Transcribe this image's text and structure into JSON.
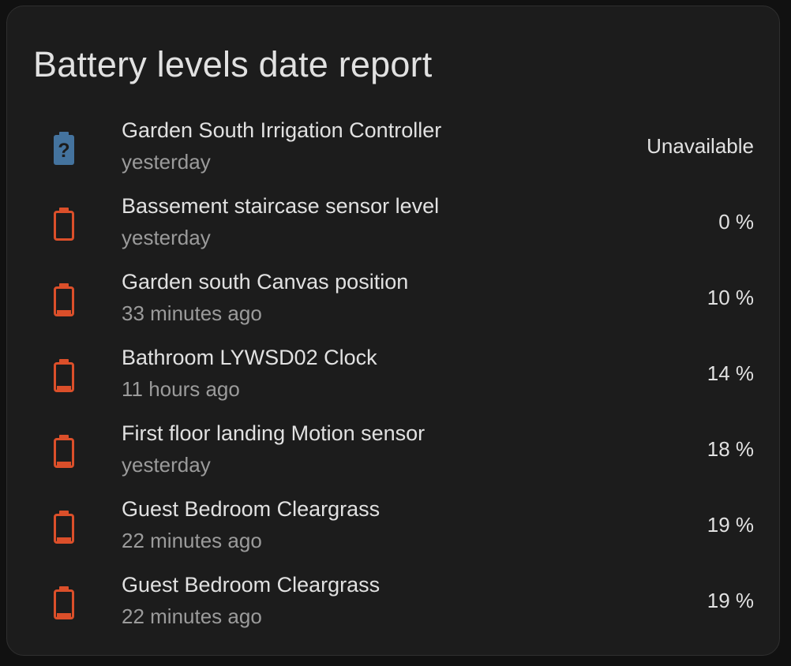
{
  "card": {
    "title": "Battery levels date report"
  },
  "colors": {
    "unknown_battery": "#44739e",
    "low_battery": "#db4f2a",
    "card_background": "#1c1c1c"
  },
  "entities": [
    {
      "name": "Garden South Irrigation Controller",
      "last_changed": "yesterday",
      "value": "Unavailable",
      "icon": "battery-unknown-icon",
      "status": "unknown"
    },
    {
      "name": "Bassement staircase sensor level",
      "last_changed": "yesterday",
      "value": "0 %",
      "icon": "battery-outline-icon",
      "status": "low"
    },
    {
      "name": "Garden south Canvas position",
      "last_changed": "33 minutes ago",
      "value": "10 %",
      "icon": "battery-10-icon",
      "status": "low"
    },
    {
      "name": "Bathroom LYWSD02 Clock",
      "last_changed": "11 hours ago",
      "value": "14 %",
      "icon": "battery-10-icon",
      "status": "low"
    },
    {
      "name": "First floor landing Motion sensor",
      "last_changed": "yesterday",
      "value": "18 %",
      "icon": "battery-10-icon",
      "status": "low"
    },
    {
      "name": "Guest Bedroom Cleargrass",
      "last_changed": "22 minutes ago",
      "value": "19 %",
      "icon": "battery-10-icon",
      "status": "low"
    },
    {
      "name": "Guest Bedroom Cleargrass",
      "last_changed": "22 minutes ago",
      "value": "19 %",
      "icon": "battery-10-icon",
      "status": "low"
    }
  ]
}
